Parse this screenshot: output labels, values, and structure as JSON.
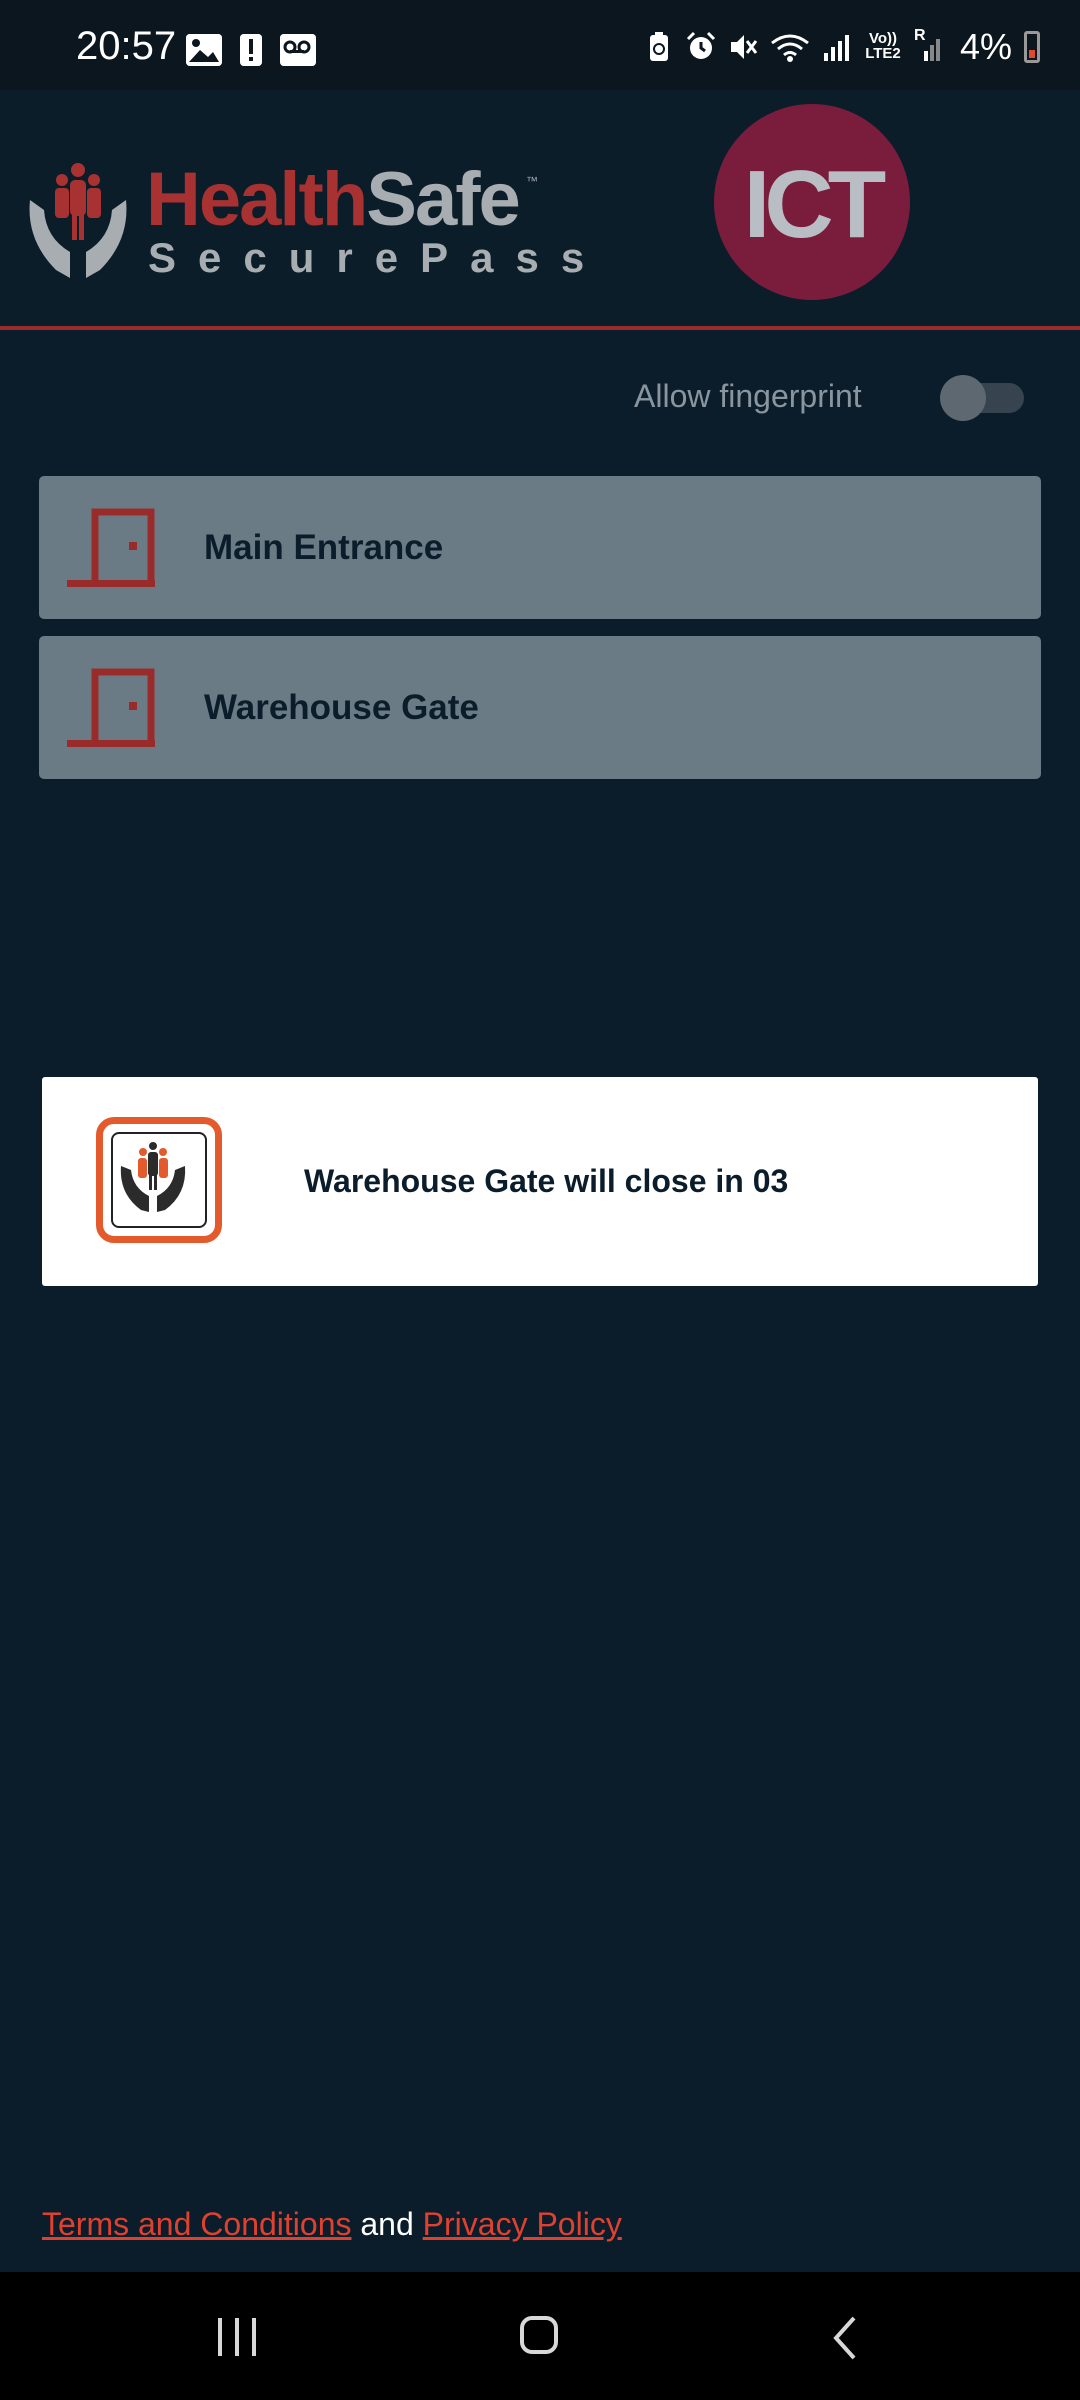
{
  "status_bar": {
    "time": "20:57",
    "left_icons": [
      "image-icon",
      "alert-icon",
      "voicemail-icon"
    ],
    "right_icons": [
      "battery-saver-icon",
      "alarm-icon",
      "mute-icon",
      "wifi-icon",
      "signal-icon",
      "lte-icon",
      "roaming-signal-icon"
    ],
    "lte_label_top": "Vo))",
    "lte_label_bottom": "LTE2",
    "roaming_label": "R",
    "battery_percent": "4%"
  },
  "header": {
    "logo_health": "Health",
    "logo_safe": "Safe",
    "logo_tm": "™",
    "logo_subtitle": "SecurePass",
    "partner_logo": "ICT"
  },
  "settings": {
    "fingerprint_label": "Allow fingerprint",
    "fingerprint_enabled": false
  },
  "doors": [
    {
      "label": "Main Entrance",
      "icon": "door-icon"
    },
    {
      "label": "Warehouse Gate",
      "icon": "door-icon"
    }
  ],
  "toast": {
    "message": "Warehouse Gate will close in 03",
    "icon": "healthsafe-app-icon"
  },
  "footer": {
    "terms_link": "Terms and Conditions",
    "connector": " and ",
    "privacy_link": "Privacy Policy"
  },
  "colors": {
    "background": "#0b1d2b",
    "accent_red": "#a83232",
    "card": "#6b7b85",
    "link": "#e0412f",
    "ict_circle": "#7a1d3c"
  }
}
